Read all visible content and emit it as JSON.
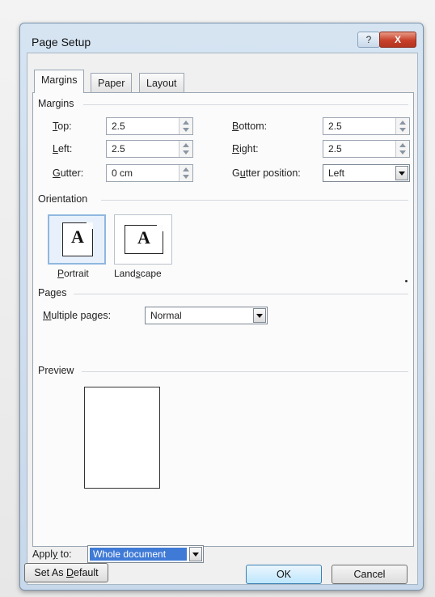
{
  "window": {
    "title": "Page Setup",
    "help_label": "?",
    "close_label": "X"
  },
  "tabs": [
    {
      "label": "Margins",
      "active": true
    },
    {
      "label": "Paper",
      "active": false
    },
    {
      "label": "Layout",
      "active": false
    }
  ],
  "margins": {
    "group_label": "Margins",
    "top": {
      "label": "Top:",
      "value": "2.5"
    },
    "bottom": {
      "label": "Bottom:",
      "value": "2.5"
    },
    "left": {
      "label": "Left:",
      "value": "2.5"
    },
    "right": {
      "label": "Right:",
      "value": "2.5"
    },
    "gutter": {
      "label": "Gutter:",
      "value": "0 cm"
    },
    "gutter_position": {
      "label": "Gutter position:",
      "value": "Left"
    }
  },
  "orientation": {
    "group_label": "Orientation",
    "portrait": {
      "label": "Portrait",
      "glyph": "A",
      "selected": true
    },
    "landscape": {
      "label": "Landscape",
      "glyph": "A",
      "selected": false
    }
  },
  "pages": {
    "group_label": "Pages",
    "multiple_pages_label": "Multiple pages:",
    "multiple_pages_value": "Normal"
  },
  "preview": {
    "group_label": "Preview"
  },
  "apply_to": {
    "label": "Apply to:",
    "value": "Whole document"
  },
  "buttons": {
    "set_default": "Set As Default",
    "ok": "OK",
    "cancel": "Cancel"
  },
  "colors": {
    "selection": "#3f7ad6",
    "close_button": "#c7402a",
    "title_bar": "#d6e4f2"
  },
  "icons": {
    "help": "question-icon",
    "close": "close-icon",
    "spinner": "spin-arrows-icon",
    "dropdown": "chevron-down-icon",
    "portrait": "portrait-page-icon",
    "landscape": "landscape-page-icon"
  }
}
